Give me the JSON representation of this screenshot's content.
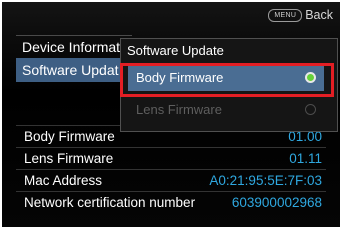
{
  "header": {
    "menu_badge": "MENU",
    "back_label": "Back"
  },
  "background_menu": {
    "items": [
      {
        "label": "Device Informat"
      },
      {
        "label": "Software Updat"
      }
    ]
  },
  "popup": {
    "title": "Software Update",
    "options": [
      {
        "label": "Body Firmware",
        "selected": true,
        "enabled": true
      },
      {
        "label": "Lens Firmware",
        "selected": false,
        "enabled": false
      }
    ]
  },
  "info": [
    {
      "label": "Body Firmware",
      "value": "01.00"
    },
    {
      "label": "Lens Firmware",
      "value": "01.11"
    },
    {
      "label": "Mac Address",
      "value": "A0:21:95:5E:7F:03"
    },
    {
      "label": "Network certification number",
      "value": "603900002968"
    }
  ],
  "colors": {
    "selection": "#4a6d93",
    "value_text": "#2fa8e0",
    "highlight_border": "#e31e24",
    "radio_on": "#66d13a"
  }
}
